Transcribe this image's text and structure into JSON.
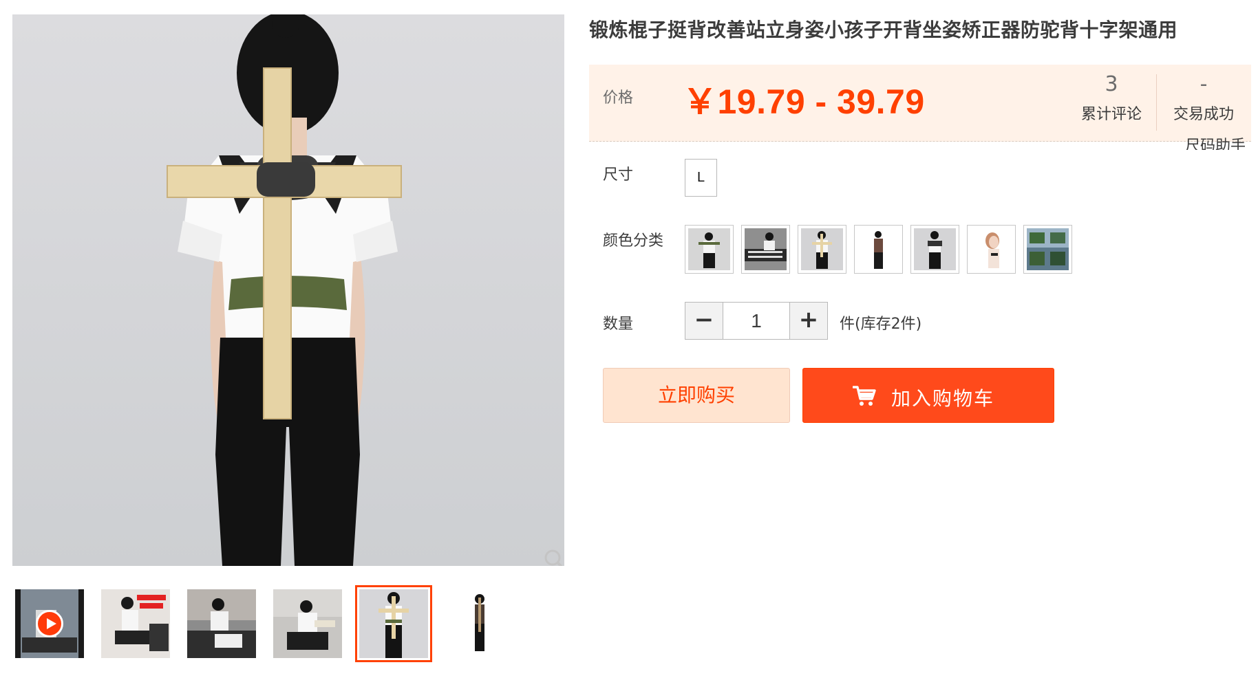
{
  "product": {
    "title": "锻炼棍子挺背改善站立身姿小孩子开背坐姿矫正器防驼背十字架通用"
  },
  "price_panel": {
    "price_label": "价格",
    "price_range": "￥19.79 - 39.79",
    "reviews_count": "3",
    "reviews_label": "累计评论",
    "sales_count": "-",
    "sales_label": "交易成功"
  },
  "size_helper": "尺码助手",
  "sku": {
    "size_label": "尺寸",
    "sizes": [
      "L"
    ],
    "color_label": "颜色分类",
    "colors_count": 7
  },
  "quantity": {
    "label": "数量",
    "minus": "−",
    "value": "1",
    "plus": "+",
    "stock_text": "件(库存2件)"
  },
  "actions": {
    "buy_now": "立即购买",
    "add_to_cart": "加入购物车"
  },
  "gallery": {
    "thumbnail_count": 6,
    "active_thumbnail": 5,
    "video_thumbnail": 1
  },
  "colors": {
    "accent": "#ff4000",
    "price_panel_bg": "#fff2e8",
    "buy_now_bg": "#ffe4d0",
    "cart_bg": "#ff4a1b"
  },
  "icons": {
    "zoom": "magnifier-icon",
    "play": "play-icon",
    "cart": "cart-icon"
  }
}
